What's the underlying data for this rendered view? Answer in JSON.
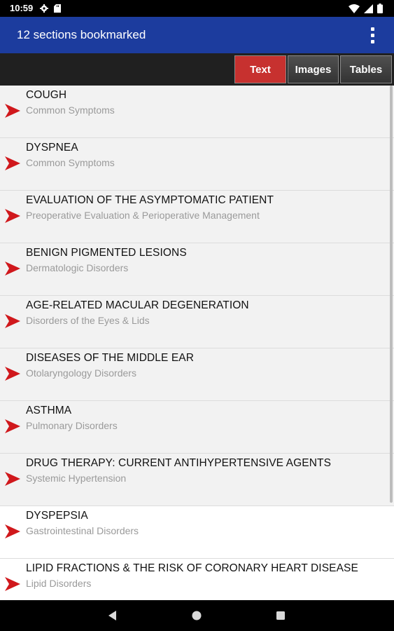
{
  "status_bar": {
    "time": "10:59",
    "icons": [
      "gear-icon",
      "sd-card-icon",
      "wifi-icon",
      "signal-icon",
      "battery-icon"
    ]
  },
  "app_bar": {
    "title": "12 sections bookmarked",
    "menu_icon": "more-vert-icon"
  },
  "tabs": [
    {
      "label": "Text",
      "active": true
    },
    {
      "label": "Images",
      "active": false
    },
    {
      "label": "Tables",
      "active": false
    }
  ],
  "bookmarks": [
    {
      "title": "COUGH",
      "subtitle": "Common Symptoms"
    },
    {
      "title": "DYSPNEA",
      "subtitle": "Common Symptoms"
    },
    {
      "title": "EVALUATION OF THE ASYMPTOMATIC PATIENT",
      "subtitle": "Preoperative Evaluation & Perioperative Management"
    },
    {
      "title": "BENIGN PIGMENTED LESIONS",
      "subtitle": "Dermatologic Disorders"
    },
    {
      "title": "AGE-RELATED MACULAR DEGENERATION",
      "subtitle": "Disorders of the Eyes & Lids"
    },
    {
      "title": "DISEASES OF THE MIDDLE EAR",
      "subtitle": "Otolaryngology Disorders"
    },
    {
      "title": "ASTHMA",
      "subtitle": "Pulmonary Disorders"
    },
    {
      "title": "DRUG THERAPY: CURRENT ANTIHYPERTENSIVE AGENTS",
      "subtitle": "Systemic Hypertension"
    },
    {
      "title": "DYSPEPSIA",
      "subtitle": "Gastrointestinal Disorders"
    },
    {
      "title": "LIPID FRACTIONS & THE RISK OF CORONARY HEART DISEASE",
      "subtitle": "Lipid Disorders"
    }
  ],
  "nav_bar": {
    "icons": [
      "back-icon",
      "home-icon",
      "recents-icon"
    ]
  },
  "colors": {
    "app_bar": "#1c3c9e",
    "active_tab": "#c7312f",
    "arrow": "#d0181c"
  }
}
